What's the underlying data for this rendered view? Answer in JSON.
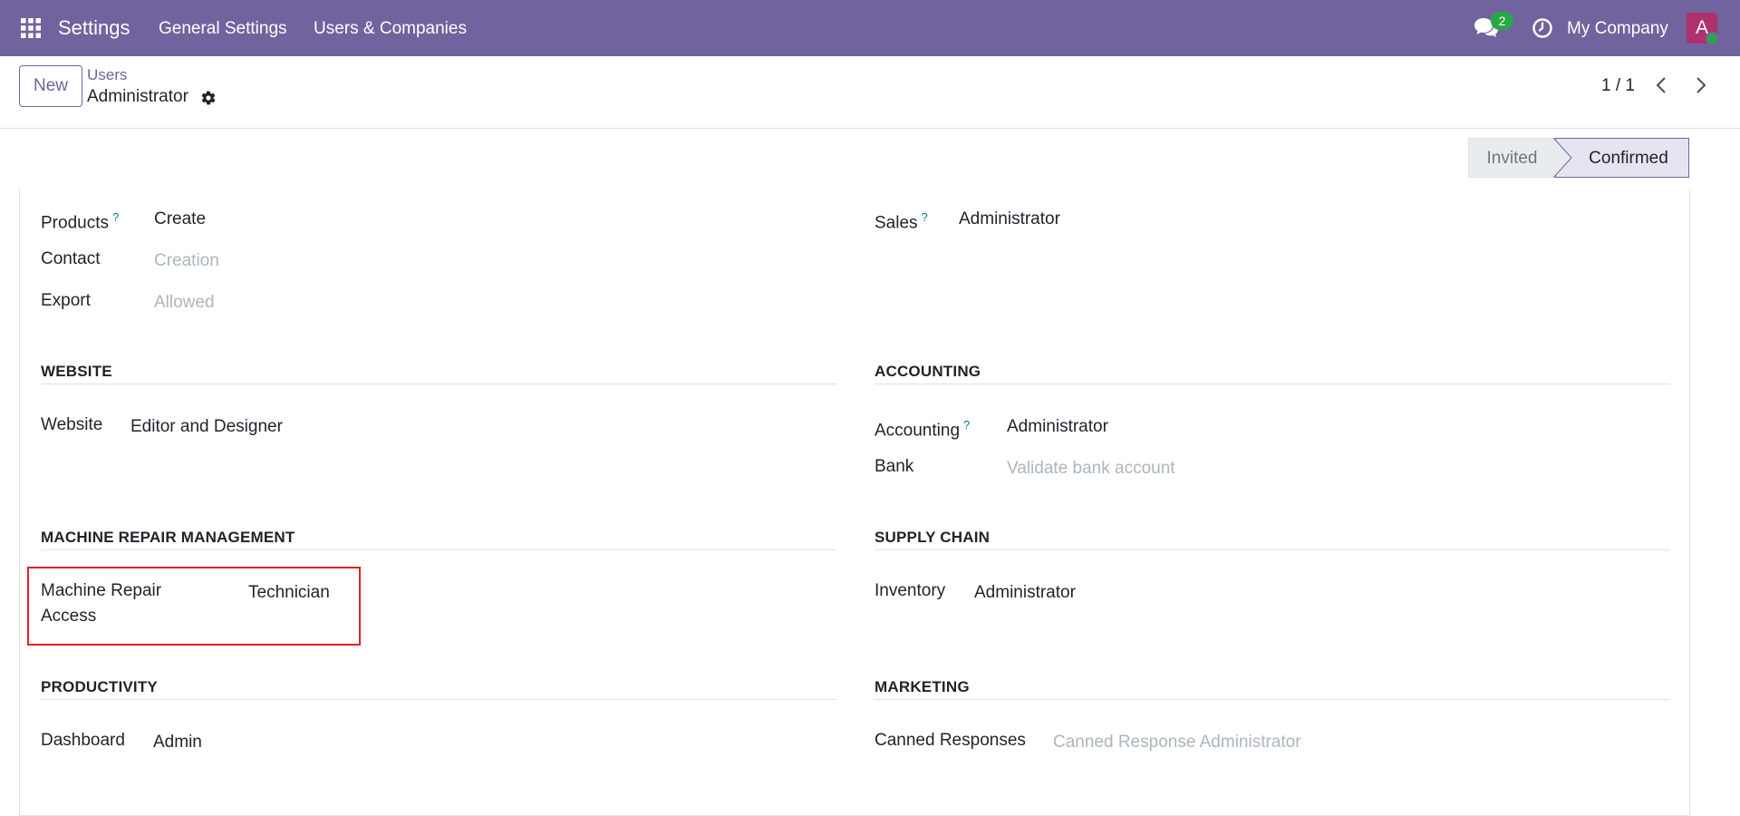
{
  "navbar": {
    "brand": "Settings",
    "menu": [
      "General Settings",
      "Users & Companies"
    ],
    "messages_count": "2",
    "company": "My Company",
    "avatar_letter": "A",
    "bg_color": "#71639e"
  },
  "control_panel": {
    "new_label": "New",
    "breadcrumb_parent": "Users",
    "breadcrumb_current": "Administrator",
    "pager": "1 / 1"
  },
  "statusbar": {
    "states": [
      "Invited",
      "Confirmed"
    ],
    "current": "Confirmed"
  },
  "fields_top": {
    "products": {
      "label": "Products",
      "help": "?",
      "value": "Create"
    },
    "contact": {
      "label": "Contact",
      "placeholder": "Creation"
    },
    "export": {
      "label": "Export",
      "placeholder": "Allowed"
    },
    "sales": {
      "label": "Sales",
      "help": "?",
      "value": "Administrator"
    }
  },
  "sections": {
    "website": {
      "title": "WEBSITE",
      "fields": [
        {
          "label": "Website",
          "value": "Editor and Designer"
        }
      ]
    },
    "accounting": {
      "title": "ACCOUNTING",
      "fields": [
        {
          "label": "Accounting",
          "help": "?",
          "value": "Administrator"
        },
        {
          "label": "Bank",
          "placeholder": "Validate bank account"
        }
      ]
    },
    "machine_repair": {
      "title": "MACHINE REPAIR MANAGEMENT",
      "fields": [
        {
          "label_line1": "Machine Repair",
          "label_line2": "Access",
          "value": "Technician"
        }
      ]
    },
    "supply_chain": {
      "title": "SUPPLY CHAIN",
      "fields": [
        {
          "label": "Inventory",
          "value": "Administrator"
        }
      ]
    },
    "productivity": {
      "title": "PRODUCTIVITY",
      "fields": [
        {
          "label": "Dashboard",
          "value": "Admin"
        }
      ]
    },
    "marketing": {
      "title": "MARKETING",
      "fields": [
        {
          "label": "Canned Responses",
          "placeholder": "Canned Response Administrator"
        }
      ]
    }
  }
}
